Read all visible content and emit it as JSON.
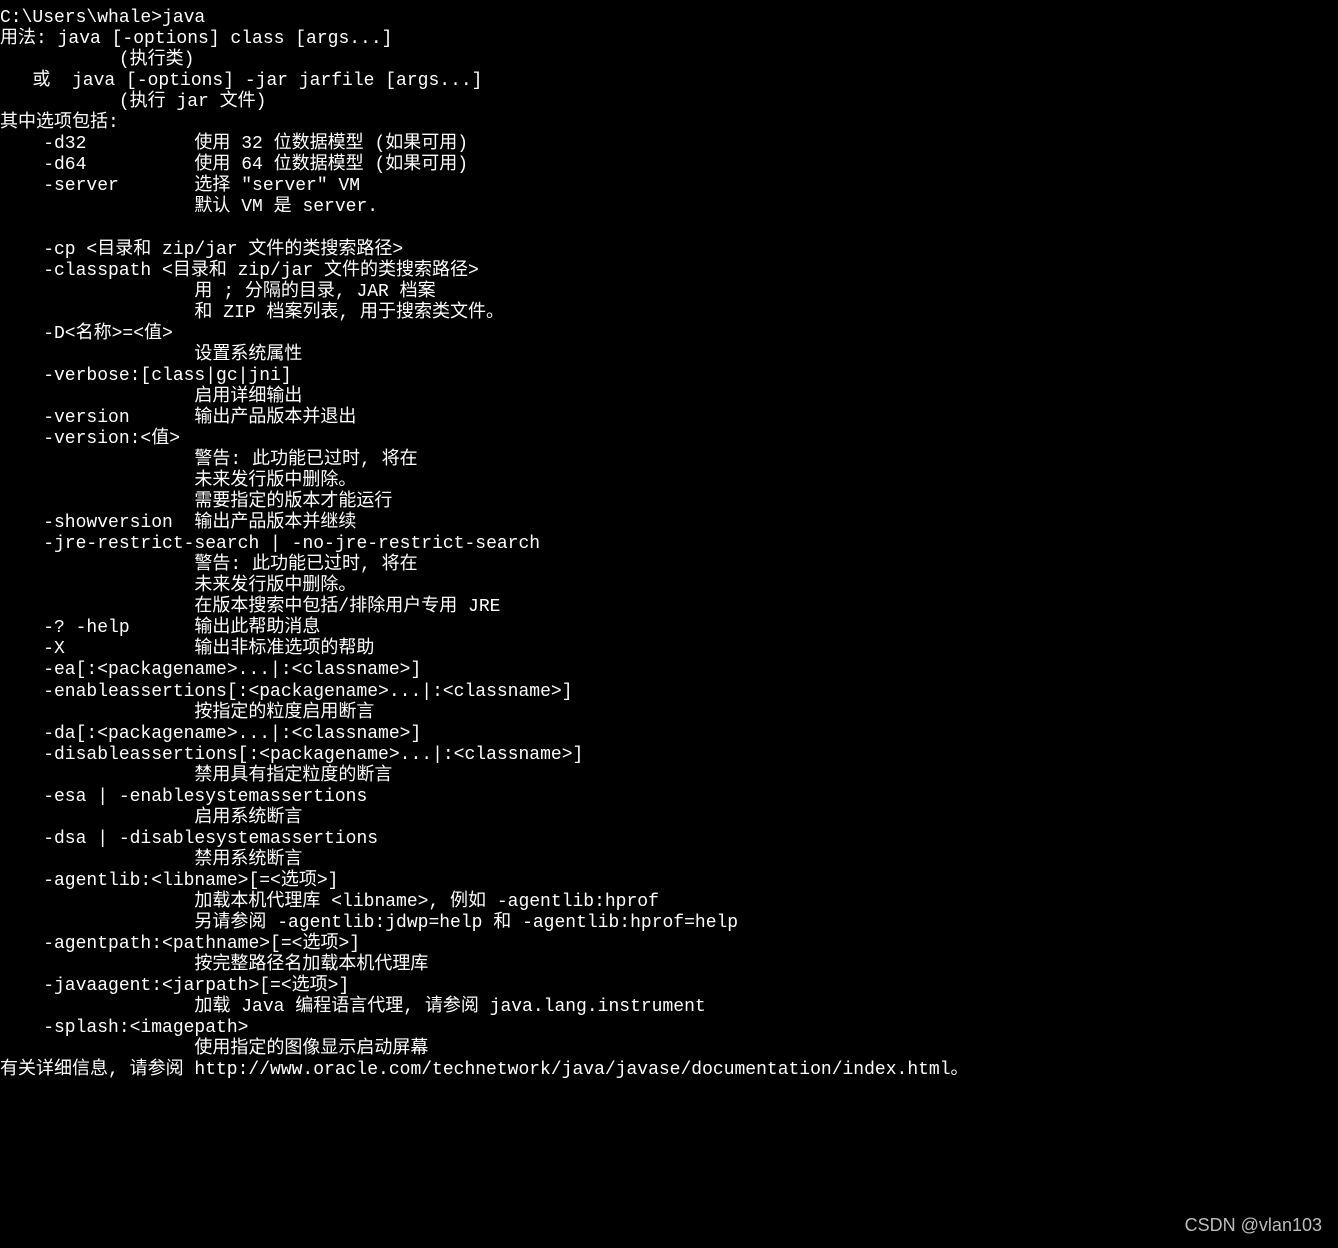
{
  "terminal": {
    "prompt": "C:\\Users\\whale>",
    "command": "java",
    "lines": [
      "C:\\Users\\whale>java",
      "用法: java [-options] class [args...]",
      "           (执行类)",
      "   或  java [-options] -jar jarfile [args...]",
      "           (执行 jar 文件)",
      "其中选项包括:",
      "    -d32          使用 32 位数据模型 (如果可用)",
      "    -d64          使用 64 位数据模型 (如果可用)",
      "    -server       选择 \"server\" VM",
      "                  默认 VM 是 server.",
      "",
      "    -cp <目录和 zip/jar 文件的类搜索路径>",
      "    -classpath <目录和 zip/jar 文件的类搜索路径>",
      "                  用 ; 分隔的目录, JAR 档案",
      "                  和 ZIP 档案列表, 用于搜索类文件。",
      "    -D<名称>=<值>",
      "                  设置系统属性",
      "    -verbose:[class|gc|jni]",
      "                  启用详细输出",
      "    -version      输出产品版本并退出",
      "    -version:<值>",
      "                  警告: 此功能已过时, 将在",
      "                  未来发行版中删除。",
      "                  需要指定的版本才能运行",
      "    -showversion  输出产品版本并继续",
      "    -jre-restrict-search | -no-jre-restrict-search",
      "                  警告: 此功能已过时, 将在",
      "                  未来发行版中删除。",
      "                  在版本搜索中包括/排除用户专用 JRE",
      "    -? -help      输出此帮助消息",
      "    -X            输出非标准选项的帮助",
      "    -ea[:<packagename>...|:<classname>]",
      "    -enableassertions[:<packagename>...|:<classname>]",
      "                  按指定的粒度启用断言",
      "    -da[:<packagename>...|:<classname>]",
      "    -disableassertions[:<packagename>...|:<classname>]",
      "                  禁用具有指定粒度的断言",
      "    -esa | -enablesystemassertions",
      "                  启用系统断言",
      "    -dsa | -disablesystemassertions",
      "                  禁用系统断言",
      "    -agentlib:<libname>[=<选项>]",
      "                  加载本机代理库 <libname>, 例如 -agentlib:hprof",
      "                  另请参阅 -agentlib:jdwp=help 和 -agentlib:hprof=help",
      "    -agentpath:<pathname>[=<选项>]",
      "                  按完整路径名加载本机代理库",
      "    -javaagent:<jarpath>[=<选项>]",
      "                  加载 Java 编程语言代理, 请参阅 java.lang.instrument",
      "    -splash:<imagepath>",
      "                  使用指定的图像显示启动屏幕",
      "有关详细信息, 请参阅 http://www.oracle.com/technetwork/java/javase/documentation/index.html。"
    ]
  },
  "watermark": "CSDN @vlan103"
}
